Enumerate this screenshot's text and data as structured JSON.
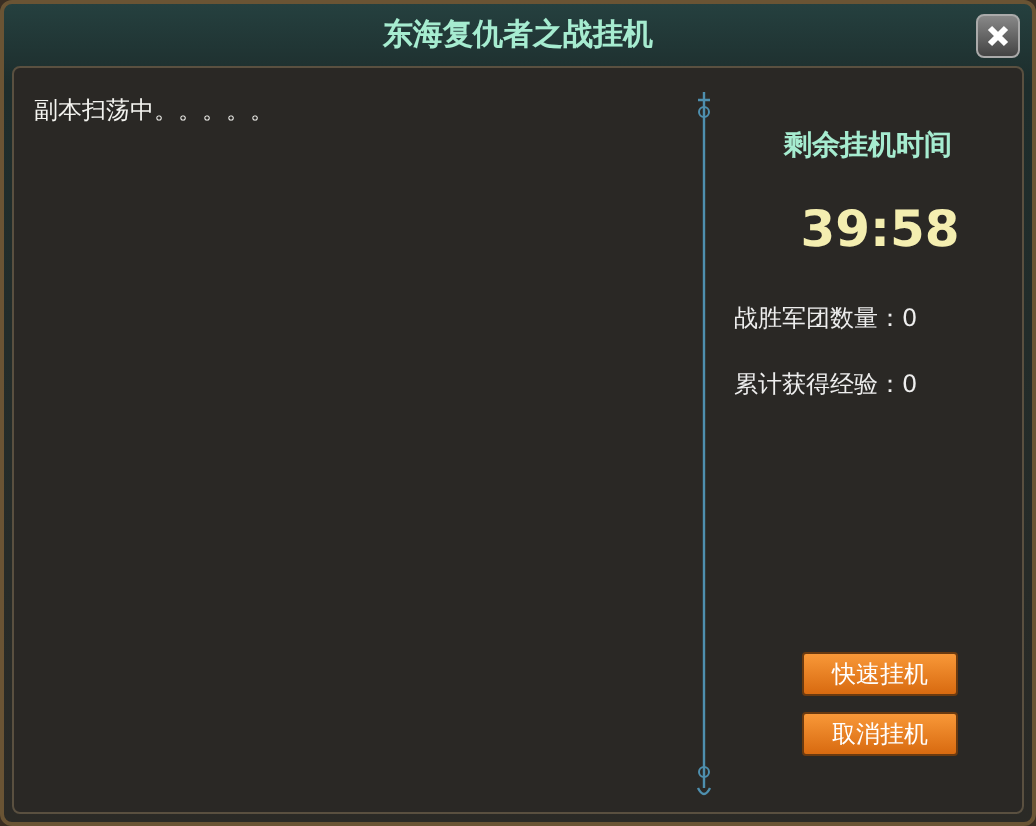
{
  "window": {
    "title": "东海复仇者之战挂机"
  },
  "log": {
    "text": "副本扫荡中。。。。。"
  },
  "timer": {
    "label": "剩余挂机时间",
    "value": "39:58"
  },
  "stats": [
    {
      "label": "战胜军团数量：",
      "value": "0"
    },
    {
      "label": "累计获得经验：",
      "value": "0"
    }
  ],
  "buttons": [
    {
      "label": "快速挂机"
    },
    {
      "label": "取消挂机"
    }
  ]
}
